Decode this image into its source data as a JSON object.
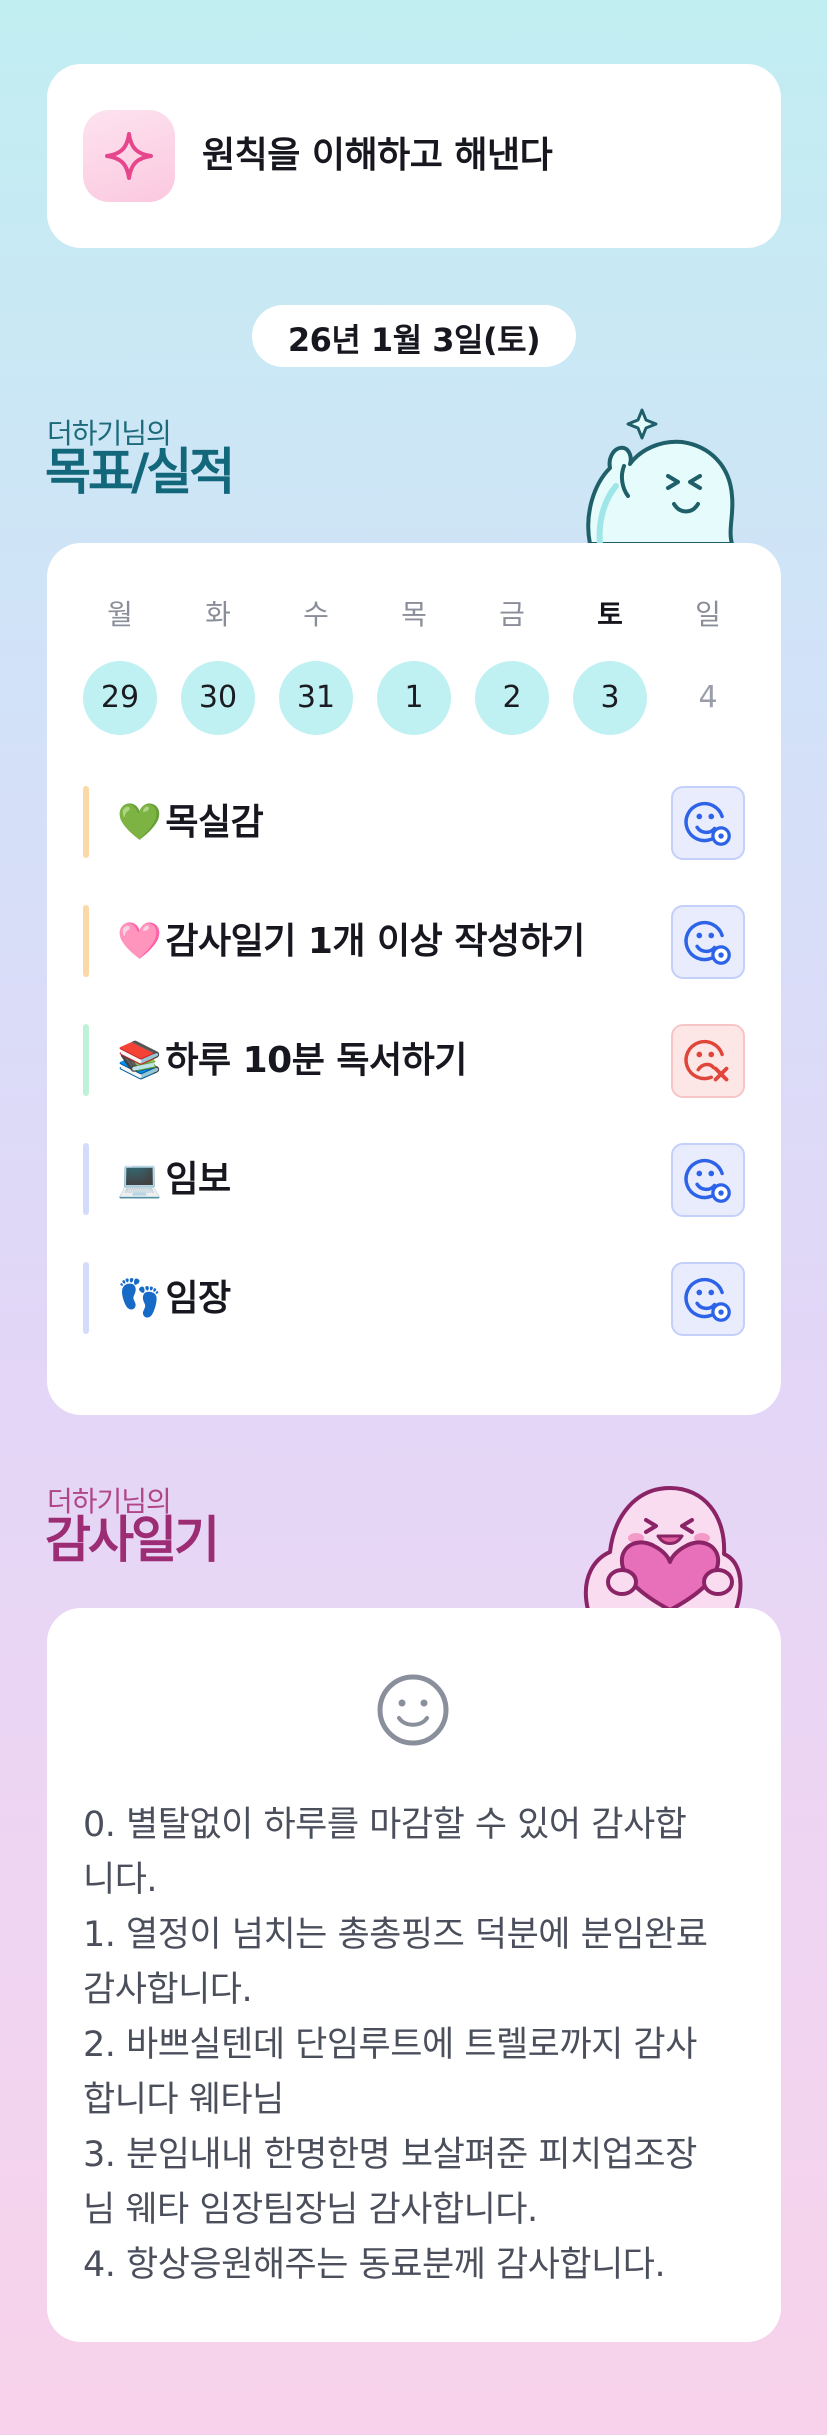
{
  "motto": {
    "text": "원칙을 이해하고 해낸다",
    "icon": "sparkle-icon"
  },
  "date": "26년 1월 3일(토)",
  "goals_section": {
    "owner_label": "더하기님의",
    "title": "목표/실적"
  },
  "week": [
    {
      "name": "월",
      "num": "29",
      "done": true,
      "today": false
    },
    {
      "name": "화",
      "num": "30",
      "done": true,
      "today": false
    },
    {
      "name": "수",
      "num": "31",
      "done": true,
      "today": false
    },
    {
      "name": "목",
      "num": "1",
      "done": true,
      "today": false
    },
    {
      "name": "금",
      "num": "2",
      "done": true,
      "today": false
    },
    {
      "name": "토",
      "num": "3",
      "done": true,
      "today": true
    },
    {
      "name": "일",
      "num": "4",
      "done": false,
      "today": false
    }
  ],
  "goals": [
    {
      "emoji": "💚",
      "label": "목실감",
      "bar_color": "#fcd7a8",
      "status": "success"
    },
    {
      "emoji": "🩷",
      "label": "감사일기 1개 이상 작성하기",
      "bar_color": "#fcd7a8",
      "status": "success"
    },
    {
      "emoji": "📚",
      "label": "하루 10분 독서하기",
      "bar_color": "#bdf1d8",
      "status": "fail"
    },
    {
      "emoji": "💻",
      "label": "임보",
      "bar_color": "#d3dcfb",
      "status": "success"
    },
    {
      "emoji": "👣",
      "label": "임장",
      "bar_color": "#d3dcfb",
      "status": "success"
    }
  ],
  "gratitude_section": {
    "owner_label": "더하기님의",
    "title": "감사일기"
  },
  "gratitude_lines": [
    "0. 별탈없이 하루를 마감할 수 있어 감사합",
    "니다.",
    "1. 열정이 넘치는 총총핑즈 덕분에 분임완료",
    "감사합니다.",
    "2. 바쁘실텐데 단임루트에 트렐로까지 감사",
    "합니다 웨타님",
    "3. 분임내내 한명한명 보살펴준 피치업조장",
    "님 웨타 임장팀장님 감사합니다.",
    "4. 항상응원해주는 동료분께 감사합니다."
  ],
  "colors": {
    "success_icon": "#2d63e8",
    "fail_icon": "#e0453a",
    "done_day": "#bff0f2"
  }
}
